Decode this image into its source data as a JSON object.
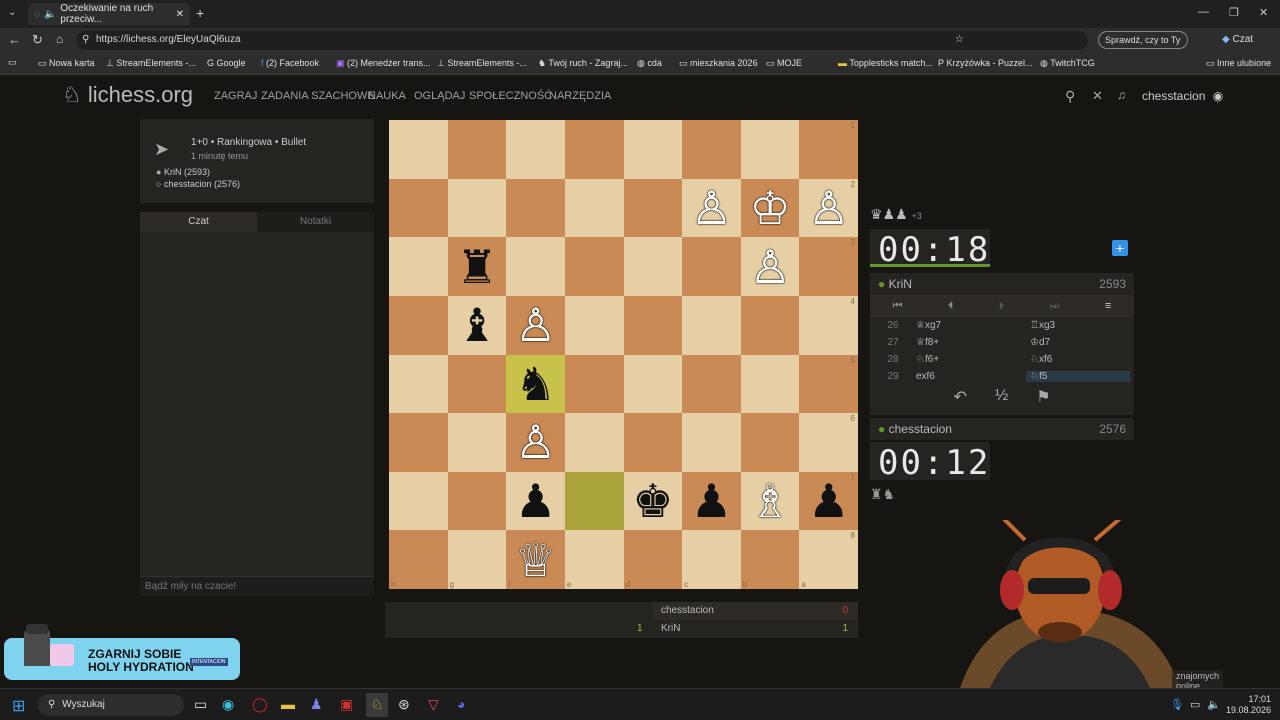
{
  "browser": {
    "tab_title": "Oczekiwanie na ruch przeciw...",
    "url": "https://lichess.org/EleyUaQl6uza",
    "sign_in_label": "Sprawdź, czy to Ty",
    "copilot_label": "Czat",
    "bookmarks": [
      "Nowa karta",
      "StreamElements -...",
      "Google",
      "(2) Facebook",
      "(2) Menedżer trans...",
      "StreamElements -...",
      "Twój ruch - Zagraj...",
      "cda",
      "mieszkania 2026",
      "MOJE",
      "Topplesticks match...",
      "Krzyżówka - Puzzel...",
      "TwitchTCG"
    ],
    "other_bookmarks": "Inne ulubione"
  },
  "site": {
    "logo": "lichess.org",
    "nav": [
      "ZAGRAJ",
      "ZADANIA SZACHOWE",
      "NAUKA",
      "OGLĄDAJ",
      "SPOŁECZNOŚĆ",
      "NARZĘDZIA"
    ],
    "username": "chesstacion"
  },
  "game_info": {
    "type": "1+0 • Rankingowa • Bullet",
    "time_ago": "1 minutę temu",
    "white_player": "KriN (2593)",
    "black_player": "chesstacion (2576)"
  },
  "chat": {
    "tab_chat": "Czat",
    "tab_notes": "Notatki",
    "placeholder": "Bądź miły na czacie!"
  },
  "board": {
    "files_bottom": [
      "h",
      "g",
      "f",
      "e",
      "d",
      "c",
      "b",
      "a"
    ],
    "ranks_right": [
      "1",
      "2",
      "3",
      "4",
      "5",
      "6",
      "7",
      "8"
    ],
    "pieces": [
      {
        "sq": "r1c5",
        "glyph": "♙",
        "color": "white"
      },
      {
        "sq": "r1c6",
        "glyph": "♔",
        "color": "white"
      },
      {
        "sq": "r1c7",
        "glyph": "♙",
        "color": "white"
      },
      {
        "sq": "r2c1",
        "glyph": "♜",
        "color": "black"
      },
      {
        "sq": "r2c6",
        "glyph": "♙",
        "color": "white"
      },
      {
        "sq": "r3c1",
        "glyph": "♝",
        "color": "black"
      },
      {
        "sq": "r3c2",
        "glyph": "♙",
        "color": "white"
      },
      {
        "sq": "r4c2",
        "glyph": "♞",
        "color": "black"
      },
      {
        "sq": "r5c2",
        "glyph": "♙",
        "color": "white"
      },
      {
        "sq": "r6c2",
        "glyph": "♟",
        "color": "black"
      },
      {
        "sq": "r6c4",
        "glyph": "♚",
        "color": "black"
      },
      {
        "sq": "r6c5",
        "glyph": "♟",
        "color": "black"
      },
      {
        "sq": "r6c6",
        "glyph": "♗",
        "color": "white"
      },
      {
        "sq": "r6c7",
        "glyph": "♟",
        "color": "black"
      },
      {
        "sq": "r7c2",
        "glyph": "♕",
        "color": "white"
      }
    ]
  },
  "opponent": {
    "material": "♛♟♟",
    "material_diff": "+3",
    "clock": "00:18",
    "name": "KriN",
    "rating": "2593"
  },
  "me": {
    "material": "♜♞",
    "clock": "00:12",
    "name": "chesstacion",
    "rating": "2576"
  },
  "moves": [
    {
      "num": "26",
      "white": "♕xg7",
      "black": "♖xg3"
    },
    {
      "num": "27",
      "white": "♕f8+",
      "black": "♔d7"
    },
    {
      "num": "28",
      "white": "♘f6+",
      "black": "♘xf6"
    },
    {
      "num": "29",
      "white": "exf6",
      "black": "♘f5"
    }
  ],
  "crosstable": {
    "row1_name": "chesstacion",
    "row1_score": "0",
    "row2_left_score": "1",
    "row2_name": "KriN",
    "row2_score": "1"
  },
  "ad": {
    "line1": "ZGARNIJ SOBIE",
    "line2": "HOLY HYDRATION",
    "brand": "INTENTACION"
  },
  "friends_online": "znajomych online",
  "taskbar": {
    "search": "Wyszukaj",
    "time": "17:01",
    "date": "19.08.2026"
  },
  "colors": {
    "light_square": "#e6cfa4",
    "dark_square": "#c98a55",
    "highlight": "#c8c24a",
    "online_dot": "#629924"
  }
}
